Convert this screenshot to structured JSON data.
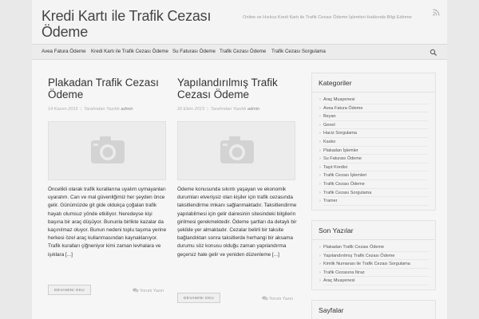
{
  "site": {
    "title": "Kredi Kartı ile Trafik Cezası Ödeme",
    "tagline": "Online ve Hızlıca Kredi Kartı ile Trafik Cezası Ödeme İşlemleri Hakkında Bilgi Edinme",
    "rss_icon": "rss-icon"
  },
  "nav": {
    "items": [
      "Avea Fatura Ödeme",
      "Kredi Kartı ile Trafik Cezası Ödeme",
      "Su Faturası Ödeme",
      "Trafik Cezası Ödeme",
      "Trafik Cezası Sorgulama"
    ],
    "search_icon": "search-icon"
  },
  "posts": [
    {
      "title": "Plakadan Trafik Cezası Ödeme",
      "date": "14 Kasım 2015",
      "author_prefix": "Tarafından Yazıldı",
      "author": "admin",
      "excerpt": "Öncelikli olarak trafik kurallarına uyalım uymayanları uyaralım. Can ve mal güvenliğimiz her şeyden önce gelir. Günümüzde git gide oldukça çoğalan trafik hayatı olumsuz yönde etkiliyor. Neredeyse kişi başına bir araç düşüyor. Bununla birlikte kazalar da kaçınılmaz oluyor. Bunun nedeni toplu taşıma yerine herkesi özel araç kullanmasından kaynaklanıyor. Trafik kuralları çiğneniyor kimi zaman levhalara ve işıklara [...]",
      "button": "DEVAMINI OKU",
      "comments": "Yorum Yazın"
    },
    {
      "title": "Yapılandırılmış Trafik Cezası Ödeme",
      "date": "26 Ekim 2015",
      "author_prefix": "Tarafından Yazıldı",
      "author": "admin",
      "excerpt": "Ödeme konusunda sıkıntı yaşayan ve ekonomik durumları elverişsiz olan kişiler için trafik cezasında taksitlendirme imkanı sağlanmaktadır. Taksitlendirme yapılabilmesi için gelir dairesinin sitesindeki bilgilerin girilmesi gerekmektedir. Ödeme şartları da detaylı bir şekilde yer almaktadır. Cezalar belirli bir taksite bağlandıktan sonra taksitlerde herhangi bir aksama durumu söz konusu olduğu zaman yapılandırma geçersiz hale gelir ve yeniden düzenleme [...]",
      "button": "DEVAMINI OKU",
      "comments": "Yorum Yazın"
    }
  ],
  "sidebar": {
    "categories": {
      "title": "Kategoriler",
      "items": [
        "Araç Muayenesi",
        "Avea Fatura Ödeme",
        "Beyan",
        "Genel",
        "Haciz Sorgulama",
        "Kasko",
        "Plakadan İşlemler",
        "Su Faturası Ödeme",
        "Taşıt Kredisi",
        "Trafik Cezası İşlemleri",
        "Trafik Cezası Ödeme",
        "Trafik Cezası Sorgulama",
        "Tramer"
      ]
    },
    "recent": {
      "title": "Son Yazılar",
      "items": [
        "Plakadan Trafik Cezası Ödeme",
        "Yapılandırılmış Trafik Cezası Ödeme",
        "Kimlik Numarası ile Trafik Cezası Sorgulama",
        "Trafik Cezasına İtiraz",
        "Araç Muayenesi"
      ]
    },
    "pages": {
      "title": "Sayfalar"
    }
  }
}
